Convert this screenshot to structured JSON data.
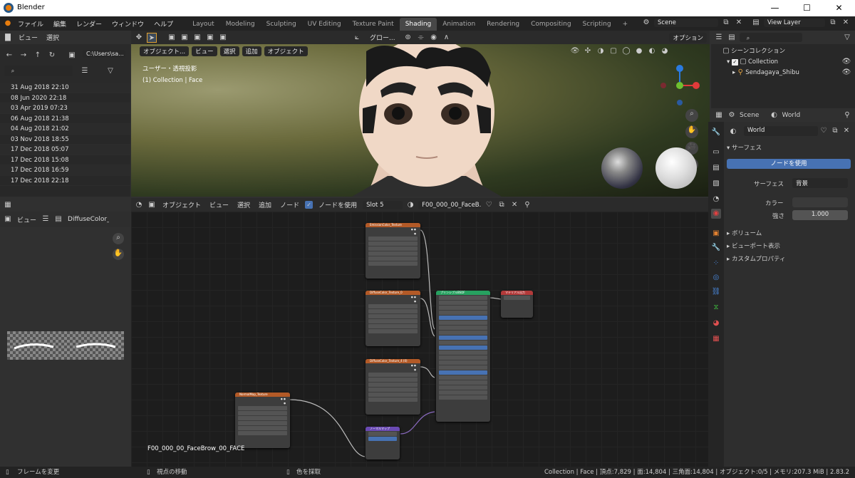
{
  "app": {
    "title": "Blender"
  },
  "menu": [
    "ファイル",
    "編集",
    "レンダー",
    "ウィンドウ",
    "ヘルプ"
  ],
  "workspaces": [
    "Layout",
    "Modeling",
    "Sculpting",
    "UV Editing",
    "Texture Paint",
    "Shading",
    "Animation",
    "Rendering",
    "Compositing",
    "Scripting"
  ],
  "active_workspace": "Shading",
  "scene": {
    "label": "Scene",
    "view_layer": "View Layer"
  },
  "filebrowser": {
    "menu": [
      "ビュー",
      "選択"
    ],
    "path": "C:\\Users\\sa...",
    "dates": [
      "31 Aug 2018 22:10",
      "08 Jun 2020 22:18",
      "03 Apr 2019 07:23",
      "06 Aug 2018 21:38",
      "04 Aug 2018 21:02",
      "03 Nov 2018 18:55",
      "17 Dec 2018 05:07",
      "17 Dec 2018 15:08",
      "17 Dec 2018 16:59",
      "17 Dec 2018 22:18"
    ]
  },
  "imageeditor": {
    "view": "ビュー",
    "image": "DiffuseColor_"
  },
  "viewport": {
    "mode": "オブジェクト...",
    "menus": [
      "ビュー",
      "選択",
      "追加",
      "オブジェクト"
    ],
    "transform": "グロー...",
    "options": "オプション",
    "overlay1": "ユーザー・透視投影",
    "overlay2": "(1) Collection | Face"
  },
  "outliner": {
    "root": "シーンコレクション",
    "collection": "Collection",
    "object": "Sendagaya_Shibu"
  },
  "properties": {
    "scene_tab": "Scene",
    "world_tab": "World",
    "world_name": "World",
    "surface_section": "サーフェス",
    "use_nodes": "ノードを使用",
    "surface_label": "サーフェス",
    "surface_value": "背景",
    "color_label": "カラー",
    "strength_label": "強さ",
    "strength_value": "1.000",
    "volume": "ボリューム",
    "viewport_display": "ビューポート表示",
    "custom_props": "カスタムプロパティ"
  },
  "nodeeditor": {
    "mode": "オブジェクト",
    "menus": [
      "ビュー",
      "選択",
      "追加",
      "ノード"
    ],
    "use_nodes": "ノードを使用",
    "slot": "Slot 5",
    "material": "F00_000_00_FaceB...",
    "material_label": "F00_000_00_FaceBrow_00_FACE"
  },
  "nodes": {
    "tex1": "EmissionColor_Texture",
    "tex2": "DiffuseColor_Texture_0",
    "tex3": "DiffuseColor_Texture_4 (0)",
    "normaltex": "NormalMap_Texture",
    "bsdf": "プリンシプルBSDF",
    "output": "マテリアル出力",
    "normalmap": "ノーマルマップ"
  },
  "statusbar": {
    "left": "フレームを変更",
    "mid1": "視点の移動",
    "mid2": "色を採取",
    "right": "Collection | Face | 頂点:7,829 | 面:14,804 | 三角面:14,804 | オブジェクト:0/5 | メモリ:207.3 MiB | 2.83.2"
  }
}
